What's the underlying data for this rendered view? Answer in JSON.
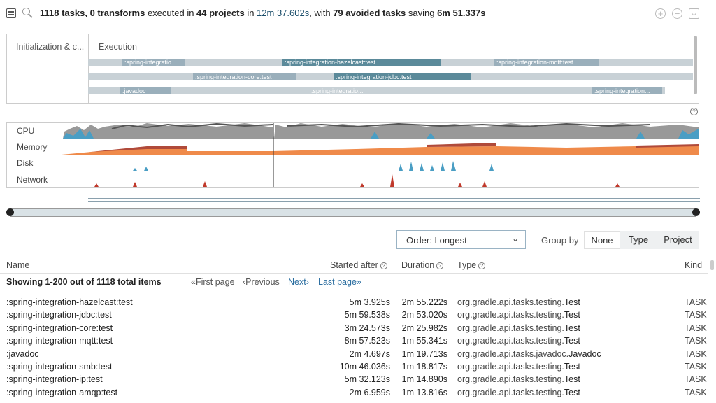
{
  "header": {
    "summary_tasks": "1118 tasks, 0 transforms",
    "summary_mid1": " executed in ",
    "summary_projects": "44 projects",
    "summary_mid2": " in ",
    "summary_time": "12m 37.602s",
    "summary_mid3": ", with ",
    "summary_avoided": "79 avoided tasks",
    "summary_mid4": " saving ",
    "summary_saving": "6m 51.337s",
    "zoom_in": "+",
    "zoom_out": "−",
    "zoom_reset": "↔"
  },
  "timeline": {
    "section_init": "Initialization & c...",
    "section_exec": "Execution",
    "bars": [
      ":spring-integratio...",
      ":spring-integration-hazelcast:test",
      ":spring-integration-mqtt:test",
      ":spring-integration-core:test",
      ":spring-integration-jdbc:test",
      ":javadoc",
      ":spring-integratio...",
      ":spring-integration..."
    ],
    "help": "?"
  },
  "resources": {
    "labels": [
      "CPU",
      "Memory",
      "Disk",
      "Network"
    ],
    "colors": {
      "cpu_gray": "#999999",
      "cpu_blue": "#4a9ec4",
      "memory_dark": "#b04a3a",
      "memory_orange": "#ef8a4a",
      "disk_blue": "#4a9ec4",
      "network_red": "#c0392b"
    }
  },
  "controls": {
    "order_label": "Order: Longest",
    "group_by_label": "Group by",
    "group_options": [
      "None",
      "Type",
      "Project"
    ],
    "group_selected": "None"
  },
  "table": {
    "headers": {
      "name": "Name",
      "started": "Started after",
      "duration": "Duration",
      "type": "Type",
      "kind": "Kind"
    },
    "showing": "Showing 1-200 out of 1118 total items",
    "pager": {
      "first": "«First page",
      "previous": "‹Previous",
      "next": "Next›",
      "last": "Last page»"
    },
    "rows": [
      {
        "name": ":spring-integration-hazelcast:test",
        "started": "5m 3.925s",
        "duration": "2m 55.222s",
        "type_prefix": "org.gradle.api.tasks.testing.",
        "type_name": "Test",
        "kind": "TASK"
      },
      {
        "name": ":spring-integration-jdbc:test",
        "started": "5m 59.538s",
        "duration": "2m 53.020s",
        "type_prefix": "org.gradle.api.tasks.testing.",
        "type_name": "Test",
        "kind": "TASK"
      },
      {
        "name": ":spring-integration-core:test",
        "started": "3m 24.573s",
        "duration": "2m 25.982s",
        "type_prefix": "org.gradle.api.tasks.testing.",
        "type_name": "Test",
        "kind": "TASK"
      },
      {
        "name": ":spring-integration-mqtt:test",
        "started": "8m 57.523s",
        "duration": "1m 55.341s",
        "type_prefix": "org.gradle.api.tasks.testing.",
        "type_name": "Test",
        "kind": "TASK"
      },
      {
        "name": ":javadoc",
        "started": "2m 4.697s",
        "duration": "1m 19.713s",
        "type_prefix": "org.gradle.api.tasks.javadoc.",
        "type_name": "Javadoc",
        "kind": "TASK"
      },
      {
        "name": ":spring-integration-smb:test",
        "started": "10m 46.036s",
        "duration": "1m 18.817s",
        "type_prefix": "org.gradle.api.tasks.testing.",
        "type_name": "Test",
        "kind": "TASK"
      },
      {
        "name": ":spring-integration-ip:test",
        "started": "5m 32.123s",
        "duration": "1m 14.890s",
        "type_prefix": "org.gradle.api.tasks.testing.",
        "type_name": "Test",
        "kind": "TASK"
      },
      {
        "name": ":spring-integration-amqp:test",
        "started": "2m 6.959s",
        "duration": "1m 13.816s",
        "type_prefix": "org.gradle.api.tasks.testing.",
        "type_name": "Test",
        "kind": "TASK"
      }
    ]
  }
}
